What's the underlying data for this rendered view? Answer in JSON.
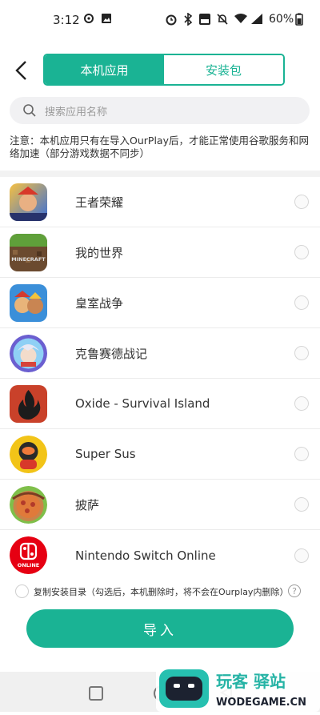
{
  "status": {
    "time": "3:12",
    "battery": "60%"
  },
  "header": {
    "tabs": [
      {
        "label": "本机应用",
        "active": true
      },
      {
        "label": "安装包",
        "active": false
      }
    ]
  },
  "search": {
    "placeholder": "搜索应用名称"
  },
  "notice": "注意：本机应用只有在导入OurPlay后，才能正常使用谷歌服务和网络加速（部分游戏数据不同步）",
  "apps": [
    {
      "name": "王者荣耀",
      "icon": "honor-of-kings-icon"
    },
    {
      "name": "我的世界",
      "icon": "minecraft-icon"
    },
    {
      "name": "皇室战争",
      "icon": "clash-royale-icon"
    },
    {
      "name": "克鲁赛德战记",
      "icon": "crusaders-quest-icon"
    },
    {
      "name": "Oxide - Survival Island",
      "icon": "oxide-icon"
    },
    {
      "name": "Super Sus",
      "icon": "super-sus-icon"
    },
    {
      "name": "披萨",
      "icon": "pizza-icon"
    },
    {
      "name": "Nintendo Switch Online",
      "icon": "nintendo-switch-online-icon"
    }
  ],
  "icon_texts": {
    "minecraft": "MINECRAFT",
    "nintendo": "ONLINE"
  },
  "copy_option": {
    "label": "复制安装目录（勾选后，本机删除时，将不会在Ourplay内删除）",
    "help": "?"
  },
  "import_button": "导入",
  "watermark": {
    "title": "玩客 驿站",
    "url": "WODEGAME.CN"
  },
  "colors": {
    "accent": "#1ab394"
  }
}
